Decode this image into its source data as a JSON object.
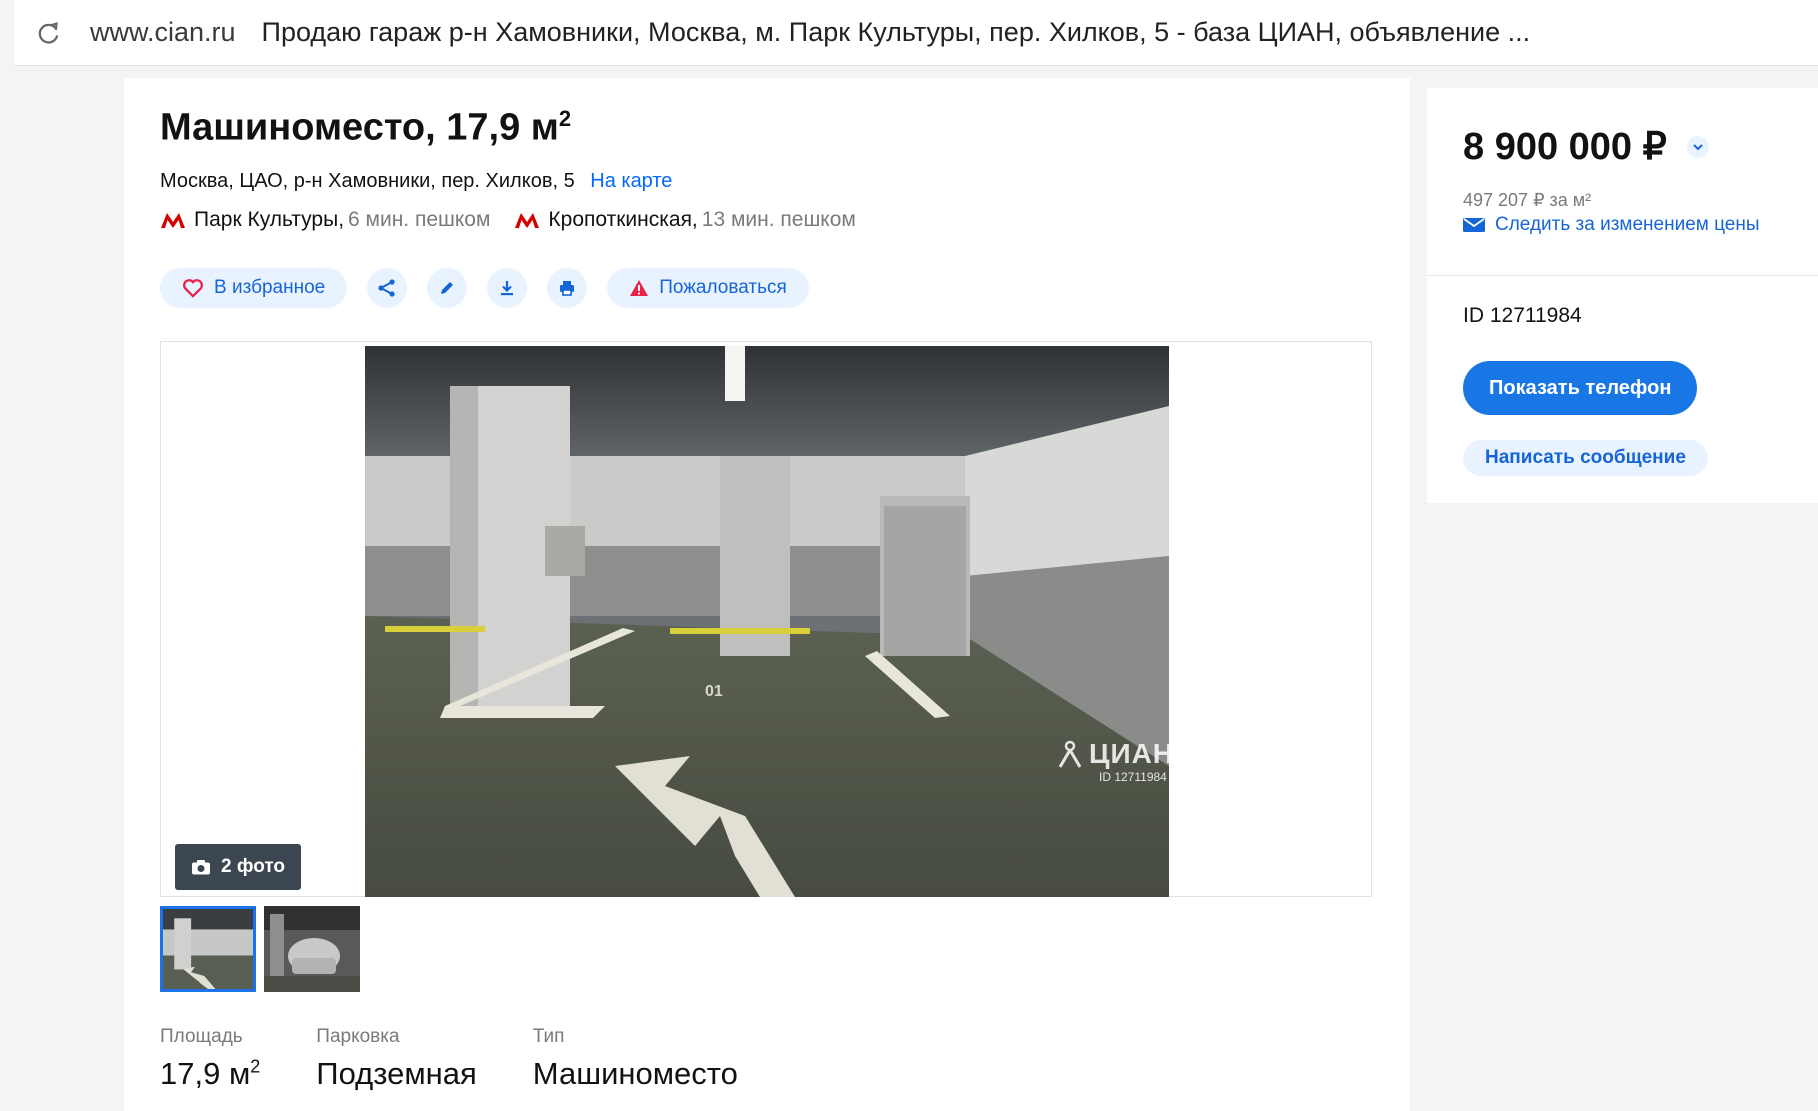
{
  "browser": {
    "domain": "www.cian.ru",
    "page_title": "Продаю гараж р-н Хамовники, Москва, м. Парк Культуры, пер. Хилков, 5 - база ЦИАН, объявление ..."
  },
  "listing": {
    "title": "Машиноместо, 17,9 м",
    "title_sup": "2",
    "address": "Москва, ЦАО, р-н Хамовники, пер. Хилков, 5",
    "map_link": "На карте",
    "metro": [
      {
        "station": "Парк Культуры,",
        "walk": "6 мин. пешком"
      },
      {
        "station": "Кропоткинская,",
        "walk": "13 мин. пешком"
      }
    ],
    "actions": {
      "favorite": "В избранное",
      "report": "Пожаловаться"
    }
  },
  "gallery": {
    "photo_count": "2 фото",
    "watermark": "ЦИАН",
    "watermark_id": "ID 12711984",
    "thumbnail_count": 2
  },
  "specs": [
    {
      "label": "Площадь",
      "value": "17,9 м",
      "sup": "2"
    },
    {
      "label": "Парковка",
      "value": "Подземная",
      "sup": ""
    },
    {
      "label": "Тип",
      "value": "Машиноместо",
      "sup": ""
    }
  ],
  "sidebar": {
    "price": "8 900 000 ₽",
    "price_per_m2": "497 207 ₽ за м²",
    "watch_price": "Следить за изменением цены",
    "listing_id": "ID 12711984",
    "show_phone": "Показать телефон",
    "write_message": "Написать сообщение"
  },
  "colors": {
    "accent": "#1877e5",
    "link": "#0468ff",
    "pill_bg": "#e9f2ff",
    "metro": "#d40000"
  }
}
